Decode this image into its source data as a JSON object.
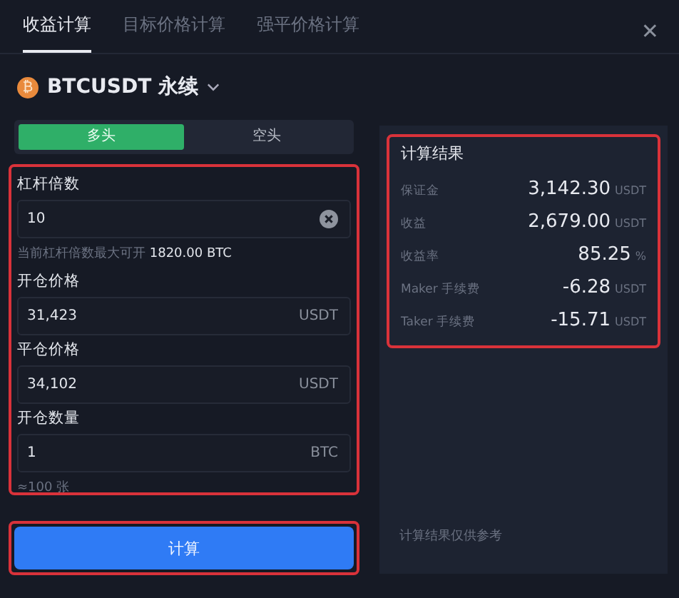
{
  "tabs": [
    {
      "label": "收益计算",
      "selected": true
    },
    {
      "label": "目标价格计算",
      "selected": false
    },
    {
      "label": "强平价格计算",
      "selected": false
    }
  ],
  "close": "✕",
  "symbol": {
    "name": "BTCUSDT 永续",
    "coin_mark": "₿"
  },
  "sides": [
    {
      "label": "多头",
      "selected": true
    },
    {
      "label": "空头",
      "selected": false
    }
  ],
  "fields": [
    {
      "label": "杠杆倍数",
      "value": "10",
      "kind": "clear",
      "note": "当前杠杆倍数最大可开 **1820.00 BTC**"
    },
    {
      "label": "开仓价格",
      "value": "31,423",
      "kind": "unit",
      "unit": "USDT"
    },
    {
      "label": "平仓价格",
      "value": "34,102",
      "kind": "unit",
      "unit": "USDT"
    },
    {
      "label": "开仓数量",
      "value": "1",
      "kind": "unit",
      "unit": "BTC",
      "note": "≈100 张"
    }
  ],
  "calculate_button": "计算",
  "results": {
    "title": "计算结果",
    "rows": [
      {
        "label": "保证金",
        "value": "3,142.30",
        "unit": "USDT"
      },
      {
        "label": "收益",
        "value": "2,679.00",
        "unit": "USDT"
      },
      {
        "label": "收益率",
        "value": "85.25",
        "unit": "%"
      },
      {
        "label": "Maker 手续费",
        "value": "-6.28",
        "unit": "USDT"
      },
      {
        "label": "Taker 手续费",
        "value": "-15.71",
        "unit": "USDT"
      }
    ],
    "disclaimer": "计算结果仅供参考"
  }
}
